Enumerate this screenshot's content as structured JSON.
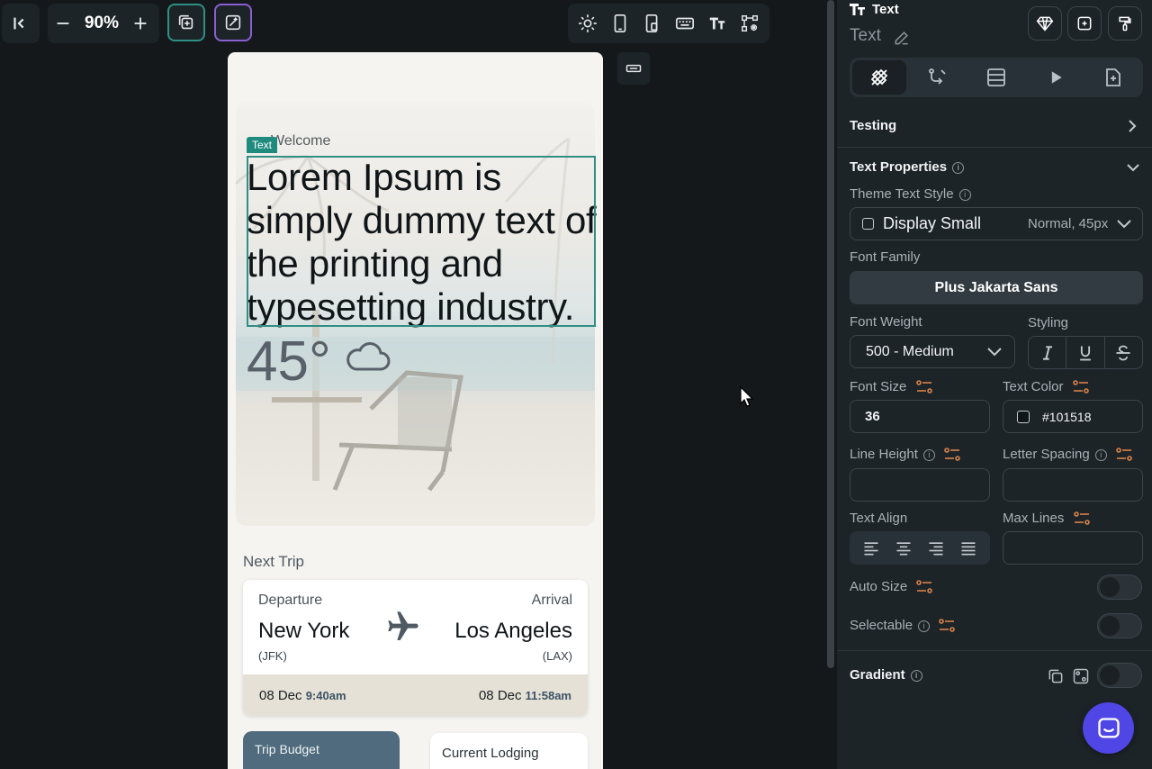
{
  "toolbar": {
    "zoom": "90%"
  },
  "canvas": {
    "selection_tag": "Text",
    "welcome": "Welcome",
    "headline": "Lorem Ipsum is simply dummy text of the printing and typesetting industry.",
    "temperature": "45°",
    "next_trip_label": "Next Trip",
    "trip": {
      "departure_label": "Departure",
      "arrival_label": "Arrival",
      "from_city": "New York",
      "from_code": "(JFK)",
      "to_city": "Los Angeles",
      "to_code": "(LAX)",
      "dep_date": "08 Dec",
      "dep_time": "9:40am",
      "arr_date": "08 Dec",
      "arr_time": "11:58am"
    },
    "budget_label": "Trip Budget",
    "lodging_label": "Current Lodging"
  },
  "panel": {
    "widget_type": "Text",
    "widget_name": "Text",
    "testing_label": "Testing",
    "text_properties_label": "Text Properties",
    "theme_text_style_label": "Theme Text Style",
    "theme_text_style_value": "Display Small",
    "theme_text_style_meta": "Normal, 45px",
    "font_family_label": "Font Family",
    "font_family_value": "Plus Jakarta Sans",
    "font_weight_label": "Font Weight",
    "font_weight_value": "500 - Medium",
    "styling_label": "Styling",
    "font_size_label": "Font Size",
    "font_size_value": "36",
    "text_color_label": "Text Color",
    "text_color_value": "#101518",
    "line_height_label": "Line Height",
    "letter_spacing_label": "Letter Spacing",
    "text_align_label": "Text Align",
    "max_lines_label": "Max Lines",
    "auto_size_label": "Auto Size",
    "selectable_label": "Selectable",
    "gradient_label": "Gradient"
  },
  "colors": {
    "accent_teal": "#2f8f84",
    "accent_orange": "#d9824a",
    "chat_button": "#4f46e5"
  }
}
